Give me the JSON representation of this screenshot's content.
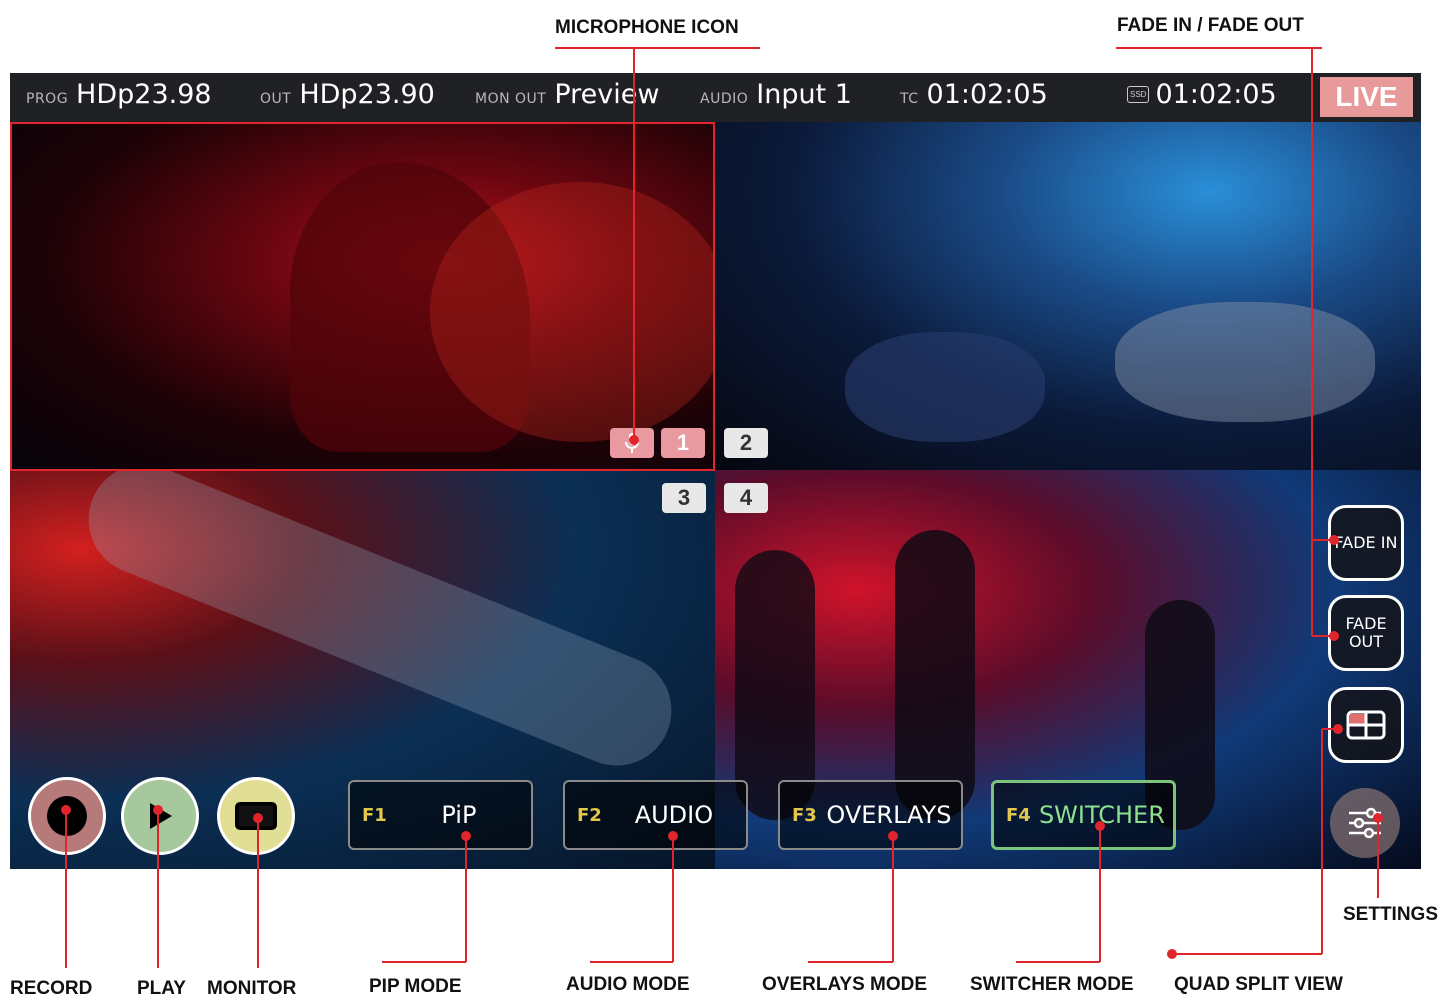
{
  "topbar": {
    "prog": {
      "label": "PROG",
      "value": "HDp23.98"
    },
    "out": {
      "label": "OUT",
      "value": "HDp23.90"
    },
    "mon_out": {
      "label": "MON OUT",
      "value": "Preview"
    },
    "audio": {
      "label": "AUDIO",
      "value": "Input 1"
    },
    "tc": {
      "label": "TC",
      "value": "01:02:05"
    },
    "ssd": {
      "icon_text": "SSD",
      "value": "01:02:05"
    },
    "live": "LIVE"
  },
  "quads": {
    "badges": [
      "1",
      "2",
      "3",
      "4"
    ]
  },
  "transport": {
    "record": "record",
    "play": "play",
    "monitor": "monitor"
  },
  "fkeys": [
    {
      "key": "F1",
      "label": "PiP"
    },
    {
      "key": "F2",
      "label": "AUDIO"
    },
    {
      "key": "F3",
      "label": "OVERLAYS"
    },
    {
      "key": "F4",
      "label": "SWITCHER"
    }
  ],
  "side": {
    "fade_in": "FADE IN",
    "fade_out": "FADE OUT"
  },
  "callouts": {
    "microphone": "MICROPHONE ICON",
    "fade": "FADE IN / FADE OUT",
    "record": "RECORD",
    "play": "PLAY",
    "monitor": "MONITOR",
    "pip": "PIP MODE",
    "audio": "AUDIO MODE",
    "overlays": "OVERLAYS MODE",
    "switcher": "SWITCHER MODE",
    "quad": "QUAD SPLIT VIEW",
    "settings": "SETTINGS"
  },
  "colors": {
    "accent": "#e0252c",
    "live": "#e89a9a",
    "fkey": "#e3c74d",
    "active": "#7bc47b"
  }
}
